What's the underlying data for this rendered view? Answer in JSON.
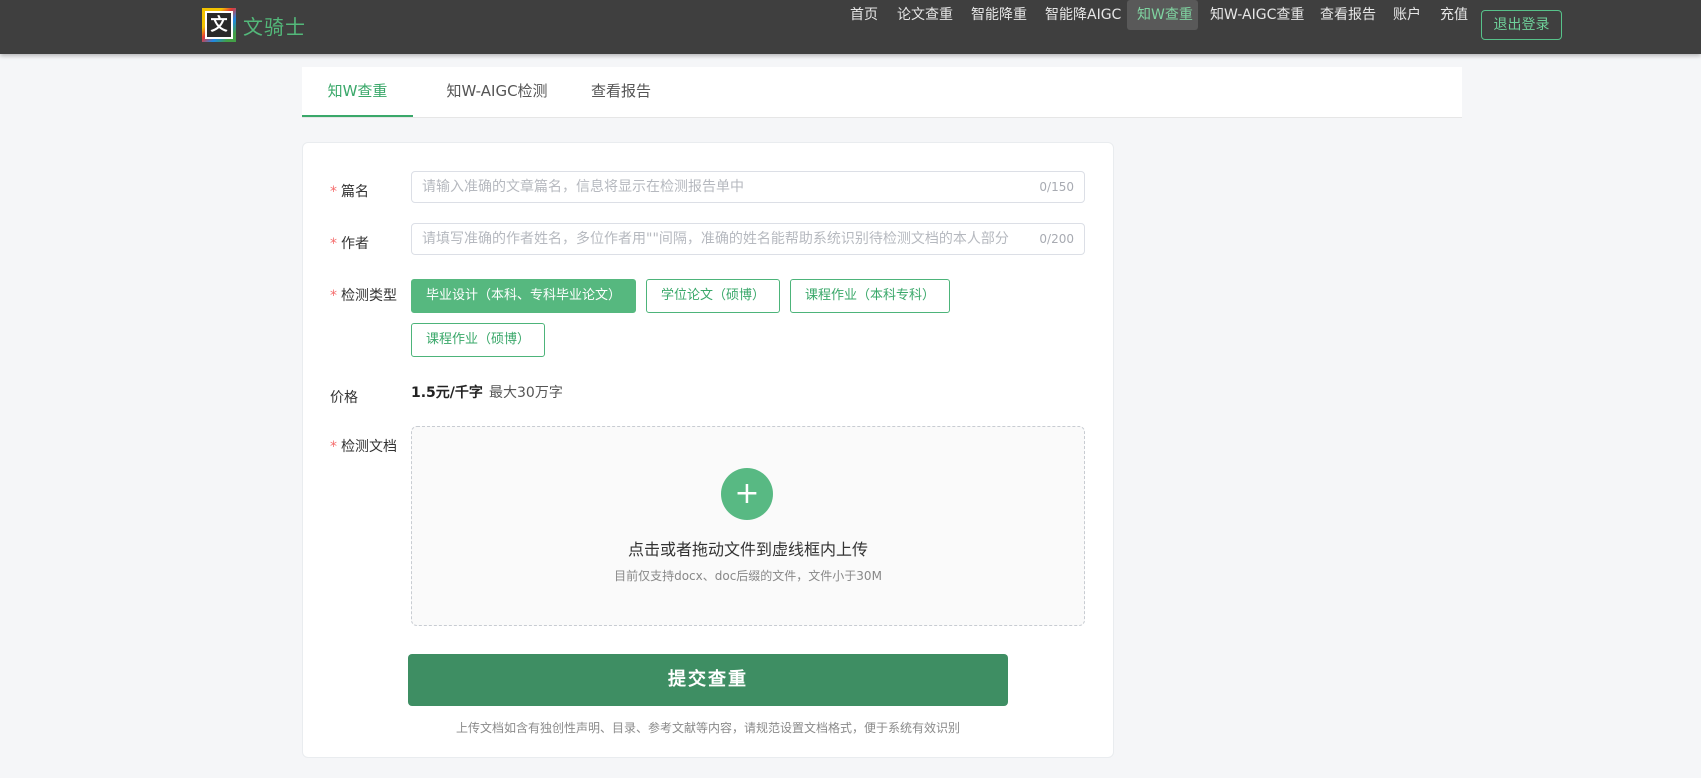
{
  "header": {
    "brand": "文骑士",
    "logo_glyph": "文",
    "nav": [
      {
        "label": "首页"
      },
      {
        "label": "论文查重"
      },
      {
        "label": "智能降重"
      },
      {
        "label": "智能降AIGC"
      },
      {
        "label": "知W查重",
        "active": true
      },
      {
        "label": "知W-AIGC查重"
      },
      {
        "label": "查看报告"
      },
      {
        "label": "账户"
      },
      {
        "label": "充值"
      }
    ],
    "logout_label": "退出登录"
  },
  "tabs": [
    {
      "label": "知W查重",
      "active": true
    },
    {
      "label": "知W-AIGC检测"
    },
    {
      "label": "查看报告"
    }
  ],
  "form": {
    "title_label": "篇名",
    "title_placeholder": "请输入准确的文章篇名，信息将显示在检测报告单中",
    "title_counter": "0/150",
    "author_label": "作者",
    "author_placeholder": "请填写准确的作者姓名，多位作者用\"\"间隔，准确的姓名能帮助系统识别待检测文档的本人部分",
    "author_counter": "0/200",
    "type_label": "检测类型",
    "types": [
      {
        "label": "毕业设计（本科、专科毕业论文）",
        "selected": true
      },
      {
        "label": "学位论文（硕博）"
      },
      {
        "label": "课程作业（本科专科）"
      },
      {
        "label": "课程作业（硕博）"
      }
    ],
    "price_label": "价格",
    "price_value": "1.5元/千字",
    "price_note": "最大30万字",
    "doc_label": "检测文档",
    "upload_icon": "+",
    "upload_title": "点击或者拖动文件到虚线框内上传",
    "upload_hint": "目前仅支持docx、doc后缀的文件，文件小于30M",
    "submit_label": "提交查重",
    "footnote": "上传文档如含有独创性声明、目录、参考文献等内容，请规范设置文档格式，便于系统有效识别"
  },
  "colors": {
    "accent": "#3aa86a",
    "submit": "#3e8e63",
    "header_bg": "#3f3f3f",
    "required": "#f56c6c"
  }
}
